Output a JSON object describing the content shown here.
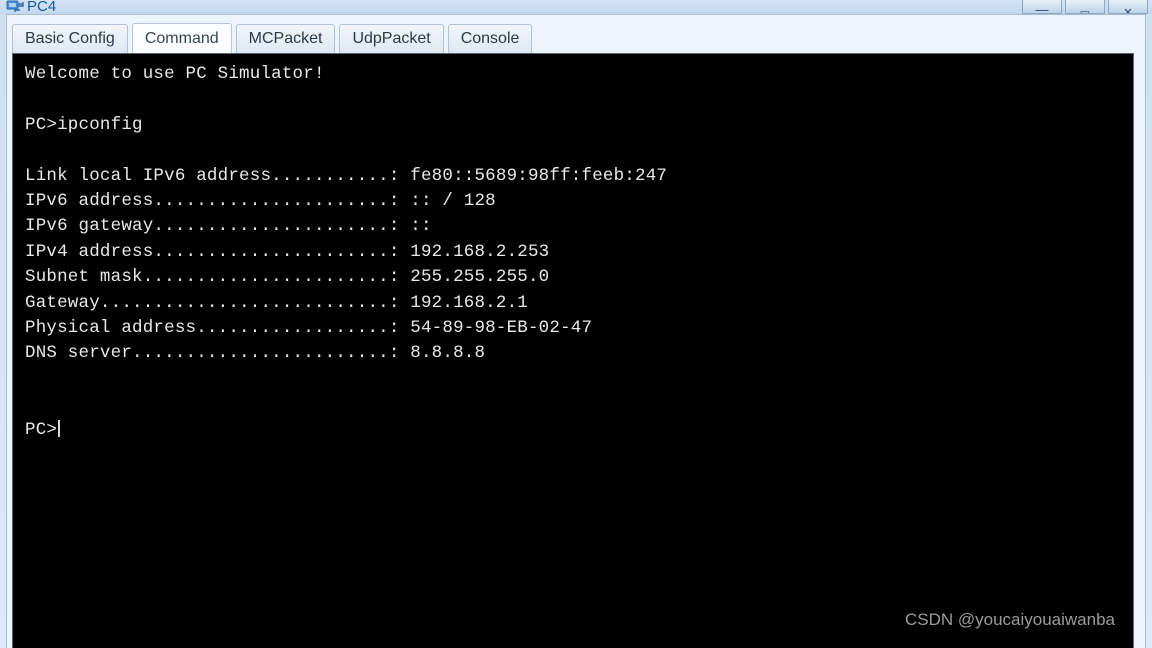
{
  "window": {
    "title": "PC4",
    "icon": "pc-device-icon",
    "controls": [
      {
        "name": "minimize-button",
        "glyph": "—"
      },
      {
        "name": "maximize-button",
        "glyph": "▭"
      },
      {
        "name": "close-button",
        "glyph": "✕"
      }
    ]
  },
  "tabs": [
    {
      "label": "Basic Config",
      "selected": false
    },
    {
      "label": "Command",
      "selected": true
    },
    {
      "label": "MCPacket",
      "selected": false
    },
    {
      "label": "UdpPacket",
      "selected": false
    },
    {
      "label": "Console",
      "selected": false
    }
  ],
  "terminal": {
    "welcome": "Welcome to use PC Simulator!",
    "blank1": "",
    "command_line": "PC>ipconfig",
    "blank2": "",
    "output": [
      "Link local IPv6 address...........: fe80::5689:98ff:feeb:247",
      "IPv6 address......................: :: / 128",
      "IPv6 gateway......................: ::",
      "IPv4 address......................: 192.168.2.253",
      "Subnet mask.......................: 255.255.255.0",
      "Gateway...........................: 192.168.2.1",
      "Physical address..................: 54-89-98-EB-02-47",
      "DNS server........................: 8.8.8.8"
    ],
    "blank3": "",
    "blank4": "",
    "prompt": "PC>"
  },
  "watermark": "CSDN @youcaiyouaiwanba"
}
